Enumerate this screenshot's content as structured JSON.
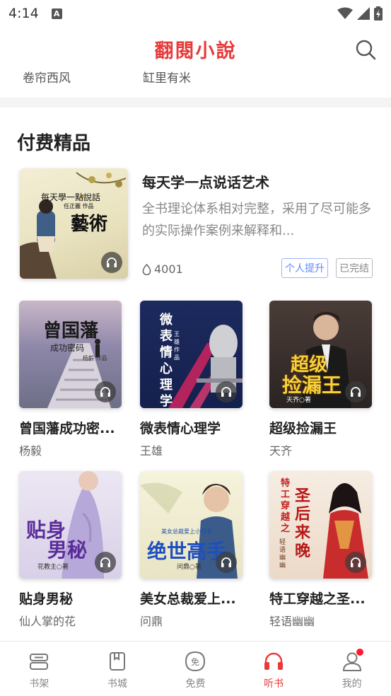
{
  "status": {
    "time": "4:14",
    "notif_icon": "A"
  },
  "header": {
    "title": "翻閱小說",
    "search_icon": "search-icon"
  },
  "authors": [
    "卷帘西风",
    "缸里有米"
  ],
  "section": {
    "title": "付费精品"
  },
  "featured": {
    "title": "每天学一点说话艺术",
    "description": "全书理论体系相对完整，采用了尽可能多的实际操作案例来解释和...",
    "listens": "4001",
    "tags": [
      "个人提升",
      "已完结"
    ],
    "cover": {
      "line1": "每天學一點說話",
      "line2": "藝術",
      "byline": "任正麗 作品"
    }
  },
  "grid": [
    {
      "title": "曾国藩成功密...",
      "author": "杨毅",
      "cover": {
        "line1": "曾国藩",
        "line2": "成功密码",
        "byline": "杨毅 作品"
      }
    },
    {
      "title": "微表情心理学",
      "author": "王雄",
      "cover": {
        "line1": "微表情心理学",
        "byline": "王雄 作品"
      }
    },
    {
      "title": "超级捡漏王",
      "author": "天齐",
      "cover": {
        "line1": "超级",
        "line2": "捡漏王",
        "byline": "天齐○著"
      }
    },
    {
      "title": "贴身男秘",
      "author": "仙人掌的花",
      "cover": {
        "line1": "贴身",
        "line2": "男秘",
        "byline": "花教主○著"
      }
    },
    {
      "title": "美女总裁爱上...",
      "author": "问鼎",
      "cover": {
        "line1": "绝世高手",
        "line2": "美女总裁爱上小保安",
        "byline": "问鼎○著"
      }
    },
    {
      "title": "特工穿越之圣...",
      "author": "轻语幽幽",
      "cover": {
        "line1": "特工穿越之",
        "line2": "圣后来晚",
        "byline": "轻语幽幽"
      }
    }
  ],
  "nav": [
    {
      "label": "书架",
      "icon": "bookshelf-icon",
      "active": false
    },
    {
      "label": "书城",
      "icon": "bookstore-icon",
      "active": false
    },
    {
      "label": "免费",
      "icon": "free-icon",
      "active": false
    },
    {
      "label": "听书",
      "icon": "headphones-icon",
      "active": true
    },
    {
      "label": "我的",
      "icon": "profile-icon",
      "active": false
    }
  ],
  "colors": {
    "accent": "#e83a3a",
    "tag_blue": "#5c87ff",
    "badge": "#ff1a2e"
  }
}
